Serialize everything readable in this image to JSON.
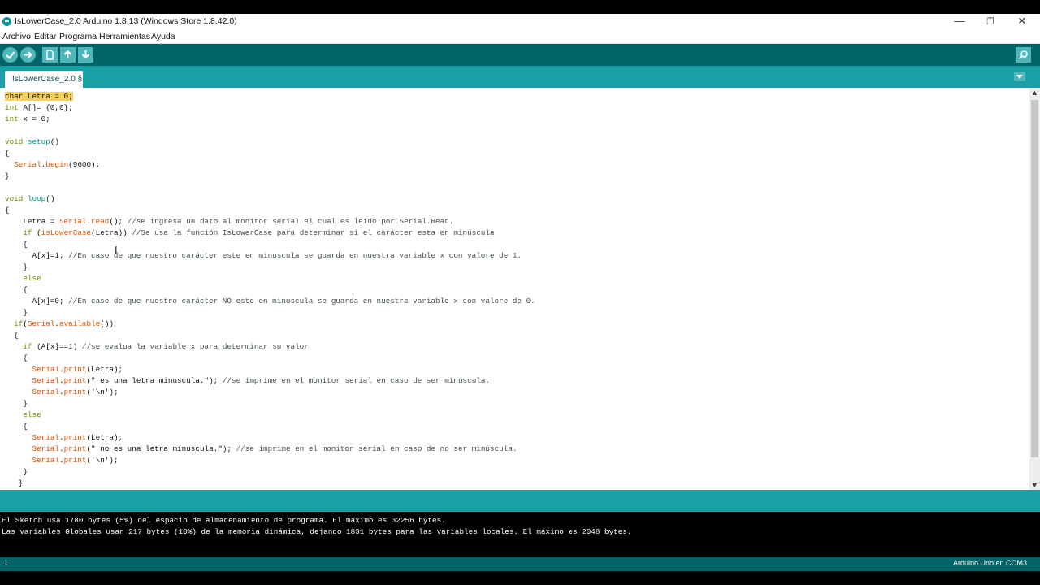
{
  "window": {
    "title": "IsLowerCase_2.0 Arduino 1.8.13 (Windows Store 1.8.42.0)",
    "controls": {
      "minimize": "—",
      "maximize": "❐",
      "close": "✕"
    }
  },
  "menu": [
    "Archivo",
    "Editar",
    "Programa",
    "Herramientas",
    "Ayuda"
  ],
  "toolbar": {
    "buttons": [
      "verify-icon",
      "upload-icon",
      "new-icon",
      "open-icon",
      "save-icon"
    ],
    "serial_monitor": "serial-monitor-icon"
  },
  "tab": {
    "label": "IsLowerCase_2.0 §"
  },
  "code": {
    "l1": "char Letra = 0;",
    "l2a": "int",
    "l2b": " A[]= {0,0};",
    "l3a": "int",
    "l3b": " x = 0;",
    "l5a": "void",
    "l5b": " setup",
    "l5c": "()",
    "l6": "{",
    "l7a": "  ",
    "l7b": "Serial",
    "l7c": ".",
    "l7d": "begin",
    "l7e": "(9600);",
    "l8": "}",
    "l10a": "void",
    "l10b": " loop",
    "l10c": "()",
    "l11": "{",
    "l12a": "    Letra = ",
    "l12b": "Serial",
    "l12c": ".",
    "l12d": "read",
    "l12e": "(); ",
    "l12f": "//se ingresa un dato al monitor serial el cual es leido por Serial.Read.",
    "l13a": "    ",
    "l13b": "if",
    "l13c": " (",
    "l13d": "isLowerCase",
    "l13e": "(Letra)) ",
    "l13f": "//Se usa la función IsLowerCase para determinar si el carácter esta en minúscula",
    "l14": "    {",
    "l15a": "      A[x]=1; ",
    "l15b": "//En caso de que nuestro carácter este en minuscula se guarda en nuestra variable x con valore de 1.",
    "l16": "    }",
    "l17a": "    ",
    "l17b": "else",
    "l18": "    {",
    "l19a": "      A[x]=0; ",
    "l19b": "//En caso de que nuestro carácter NO este en minuscula se guarda en nuestra variable x con valore de 0.",
    "l20": "    }",
    "l21a": "  ",
    "l21b": "if",
    "l21c": "(",
    "l21d": "Serial",
    "l21e": ".",
    "l21f": "available",
    "l21g": "())",
    "l22": "  {",
    "l23a": "    ",
    "l23b": "if",
    "l23c": " (A[x]==1) ",
    "l23d": "//se evalua la variable x para determinar su valor",
    "l24": "    {",
    "l25a": "      ",
    "l25b": "Serial",
    "l25c": ".",
    "l25d": "print",
    "l25e": "(Letra);",
    "l26a": "      ",
    "l26b": "Serial",
    "l26c": ".",
    "l26d": "print",
    "l26e": "(\" es una letra minuscula.\"); ",
    "l26f": "//se imprime en el monitor serial en caso de ser minúscula.",
    "l27a": "      ",
    "l27b": "Serial",
    "l27c": ".",
    "l27d": "print",
    "l27e": "('\\n');",
    "l28": "    }",
    "l29a": "    ",
    "l29b": "else",
    "l30": "    {",
    "l31a": "      ",
    "l31b": "Serial",
    "l31c": ".",
    "l31d": "print",
    "l31e": "(Letra);",
    "l32a": "      ",
    "l32b": "Serial",
    "l32c": ".",
    "l32d": "print",
    "l32e": "(\" no es una letra minuscula.\"); ",
    "l32f": "//se imprime en el monitor serial en caso de no ser minúscula.",
    "l33a": "      ",
    "l33b": "Serial",
    "l33c": ".",
    "l33d": "print",
    "l33e": "('\\n');",
    "l34": "    }",
    "l35": "   }"
  },
  "console": {
    "line1": "El Sketch usa 1780 bytes (5%) del espacio de almacenamiento de programa. El máximo es 32256 bytes.",
    "line2": "Las variables Globales usan 217 bytes (10%) de la memoria dinámica, dejando 1831 bytes para las variables locales. El máximo es 2048 bytes."
  },
  "footer": {
    "line_number": "1",
    "board": "Arduino Uno en COM3"
  },
  "colors": {
    "toolbar": "#006468",
    "tabbar": "#17a1a5",
    "button": "#4db7bb"
  }
}
